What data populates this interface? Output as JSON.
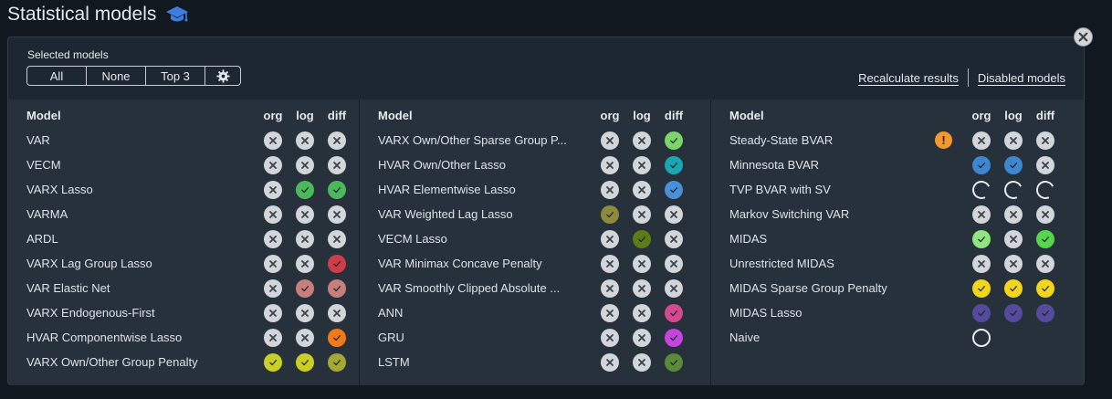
{
  "page": {
    "title": "Statistical models",
    "title_icon": "graduation-cap-icon"
  },
  "selection": {
    "label": "Selected models",
    "buttons": [
      "All",
      "None",
      "Top 3"
    ],
    "settings_icon": "gear-icon"
  },
  "links": {
    "recalculate": "Recalculate results",
    "disabled": "Disabled models"
  },
  "columns_header": {
    "model": "Model",
    "org": "org",
    "log": "log",
    "diff": "diff"
  },
  "status_colors": {
    "x": "#d2d5d9",
    "yellowgreen": "#c9cf26",
    "olive": "#a5a831",
    "green": "#4cb85c",
    "rose": "#c57f7c",
    "red": "#cf3d4c",
    "orange": "#f07a16",
    "lime": "#7bd66a",
    "teal": "#1ba6b4",
    "blue": "#4a90d9",
    "khaki": "#8d8b3d",
    "darkgreen": "#5c7c16",
    "pink": "#d44a92",
    "purple": "#c544e0",
    "mossgreen": "#5d8a3a",
    "steelblue": "#3e86cf",
    "lightgreen": "#8fe57e",
    "brightgreen": "#56d64a",
    "yellow": "#f3d51c",
    "indigo": "#544b9c"
  },
  "tables": [
    {
      "rows": [
        {
          "name": "VAR",
          "org": "x",
          "log": "x",
          "diff": "x"
        },
        {
          "name": "VECM",
          "org": "x",
          "log": "x",
          "diff": "x"
        },
        {
          "name": "VARX Lasso",
          "org": "x",
          "log": "green",
          "diff": "green"
        },
        {
          "name": "VARMA",
          "org": "x",
          "log": "x",
          "diff": "x"
        },
        {
          "name": "ARDL",
          "org": "x",
          "log": "x",
          "diff": "x"
        },
        {
          "name": "VARX Lag Group Lasso",
          "org": "x",
          "log": "x",
          "diff": "red"
        },
        {
          "name": "VAR Elastic Net",
          "org": "x",
          "log": "rose",
          "diff": "rose"
        },
        {
          "name": "VARX Endogenous-First",
          "org": "x",
          "log": "x",
          "diff": "x"
        },
        {
          "name": "HVAR Componentwise Lasso",
          "org": "x",
          "log": "x",
          "diff": "orange"
        },
        {
          "name": "VARX Own/Other Group Penalty",
          "org": "yellowgreen",
          "log": "yellowgreen",
          "diff": "olive"
        }
      ]
    },
    {
      "rows": [
        {
          "name": "VARX Own/Other Sparse Group P...",
          "org": "x",
          "log": "x",
          "diff": "lime"
        },
        {
          "name": "HVAR Own/Other Lasso",
          "org": "x",
          "log": "x",
          "diff": "teal"
        },
        {
          "name": "HVAR Elementwise Lasso",
          "org": "x",
          "log": "x",
          "diff": "blue"
        },
        {
          "name": "VAR Weighted Lag Lasso",
          "org": "khaki",
          "log": "x",
          "diff": "x"
        },
        {
          "name": "VECM Lasso",
          "org": "x",
          "log": "darkgreen",
          "diff": "x"
        },
        {
          "name": "VAR Minimax Concave Penalty",
          "org": "x",
          "log": "x",
          "diff": "x"
        },
        {
          "name": "VAR Smoothly Clipped Absolute ...",
          "org": "x",
          "log": "x",
          "diff": "x"
        },
        {
          "name": "ANN",
          "org": "x",
          "log": "x",
          "diff": "pink"
        },
        {
          "name": "GRU",
          "org": "x",
          "log": "x",
          "diff": "purple"
        },
        {
          "name": "LSTM",
          "org": "x",
          "log": "x",
          "diff": "mossgreen"
        }
      ]
    },
    {
      "rows": [
        {
          "name": "Steady-State BVAR",
          "warn": "!",
          "org": "x",
          "log": "x",
          "diff": "x"
        },
        {
          "name": "Minnesota BVAR",
          "org": "steelblue",
          "log": "steelblue",
          "diff": "x"
        },
        {
          "name": "TVP BVAR with SV",
          "org": "spin",
          "log": "spin",
          "diff": "spin"
        },
        {
          "name": "Markov Switching VAR",
          "org": "x",
          "log": "x",
          "diff": "x"
        },
        {
          "name": "MIDAS",
          "org": "lightgreen",
          "log": "x",
          "diff": "brightgreen"
        },
        {
          "name": "Unrestricted MIDAS",
          "org": "x",
          "log": "x",
          "diff": "x"
        },
        {
          "name": "MIDAS Sparse Group Penalty",
          "org": "yellow",
          "log": "yellow",
          "diff": "yellow"
        },
        {
          "name": "MIDAS Lasso",
          "org": "indigo",
          "log": "indigo",
          "diff": "indigo"
        },
        {
          "name": "Naive",
          "org": "ring",
          "log": "",
          "diff": ""
        }
      ]
    }
  ]
}
